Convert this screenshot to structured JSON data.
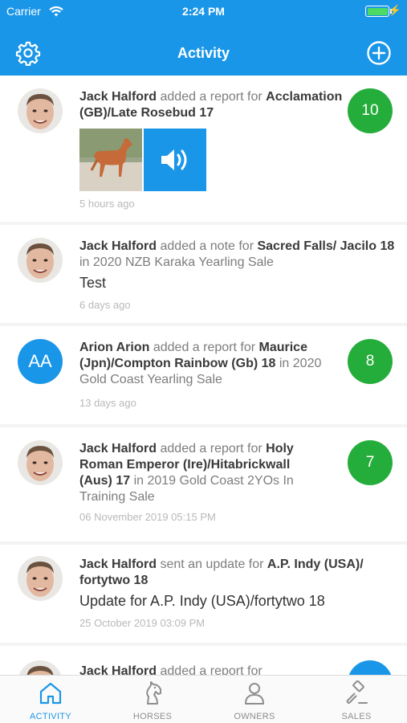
{
  "status_bar": {
    "carrier": "Carrier",
    "time": "2:24 PM"
  },
  "nav": {
    "title": "Activity",
    "left_icon": "gear-icon",
    "right_icon": "plus-circle-icon"
  },
  "colors": {
    "accent": "#1a96e8",
    "score_green": "#25ad3c"
  },
  "feed": [
    {
      "user": "Jack Halford",
      "action": " added a report for ",
      "subject": "Acclamation (GB)/Late Rosebud 17",
      "time": "5 hours ago",
      "score": "10",
      "attachments": [
        "horse-photo",
        "audio-icon"
      ]
    },
    {
      "user": "Jack Halford",
      "action": " added a note for ",
      "subject": "Sacred Falls/ Jacilo 18",
      "connector": " in ",
      "sale": "2020 NZB Karaka Yearling Sale",
      "body": "Test",
      "time": "6 days ago"
    },
    {
      "initials": "AA",
      "user": "Arion Arion",
      "action": " added a report for ",
      "subject": "Maurice (Jpn)/Compton Rainbow (Gb) 18",
      "connector": " in ",
      "sale": "2020 Gold Coast Yearling Sale",
      "time": "13 days ago",
      "score": "8"
    },
    {
      "user": "Jack Halford",
      "action": " added a report for ",
      "subject": "Holy Roman Emperor (Ire)/Hitabrickwall (Aus) 17",
      "connector": " in ",
      "sale": "2019 Gold Coast 2YOs In Training Sale",
      "time": "06 November 2019 05:15 PM",
      "score": "7"
    },
    {
      "user": "Jack Halford",
      "action": " sent an update for ",
      "subject": "A.P. Indy (USA)/ fortytwo 18",
      "body": "Update for A.P. Indy (USA)/fortytwo 18",
      "time": "25 October 2019 03:09 PM"
    },
    {
      "user": "Jack Halford",
      "action": " added a report for"
    }
  ],
  "tabs": [
    {
      "label": "ACTIVITY",
      "icon": "home-icon",
      "active": true
    },
    {
      "label": "HORSES",
      "icon": "horse-icon",
      "active": false
    },
    {
      "label": "OWNERS",
      "icon": "person-icon",
      "active": false
    },
    {
      "label": "SALES",
      "icon": "gavel-icon",
      "active": false
    }
  ]
}
